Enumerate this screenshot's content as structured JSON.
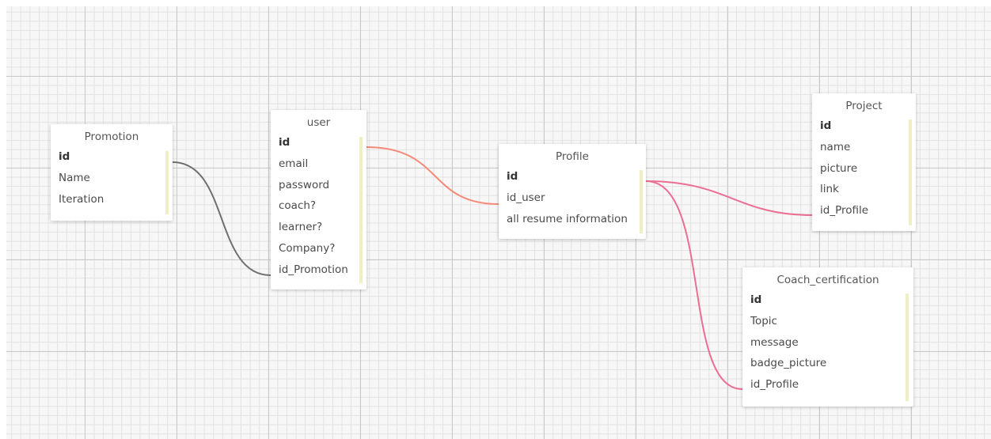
{
  "diagram": {
    "colors": {
      "link_default": "#707070",
      "link_highlight_orange": "#f58a78",
      "link_highlight_pink": "#ec6e92",
      "scrollbar": "#efefc4"
    },
    "tables": {
      "promotion": {
        "title": "Promotion",
        "fields": [
          "id",
          "Name",
          "Iteration"
        ]
      },
      "user": {
        "title": "user",
        "fields": [
          "id",
          "email",
          "password",
          "coach?",
          "learner?",
          "Company?",
          "id_Promotion"
        ]
      },
      "profile": {
        "title": "Profile",
        "fields": [
          "id",
          "id_user",
          "all resume information"
        ]
      },
      "project": {
        "title": "Project",
        "fields": [
          "id",
          "name",
          "picture",
          "link",
          "id_Profile"
        ]
      },
      "coach_certification": {
        "title": "Coach_certification",
        "fields": [
          "id",
          "Topic",
          "message",
          "badge_picture",
          "id_Profile"
        ]
      }
    },
    "relations": [
      {
        "from": "promotion.id",
        "to": "user.id_Promotion"
      },
      {
        "from": "user.id",
        "to": "profile.id_user"
      },
      {
        "from": "profile.id",
        "to": "project.id_Profile"
      },
      {
        "from": "profile.id",
        "to": "coach_certification.id_Profile"
      }
    ]
  }
}
